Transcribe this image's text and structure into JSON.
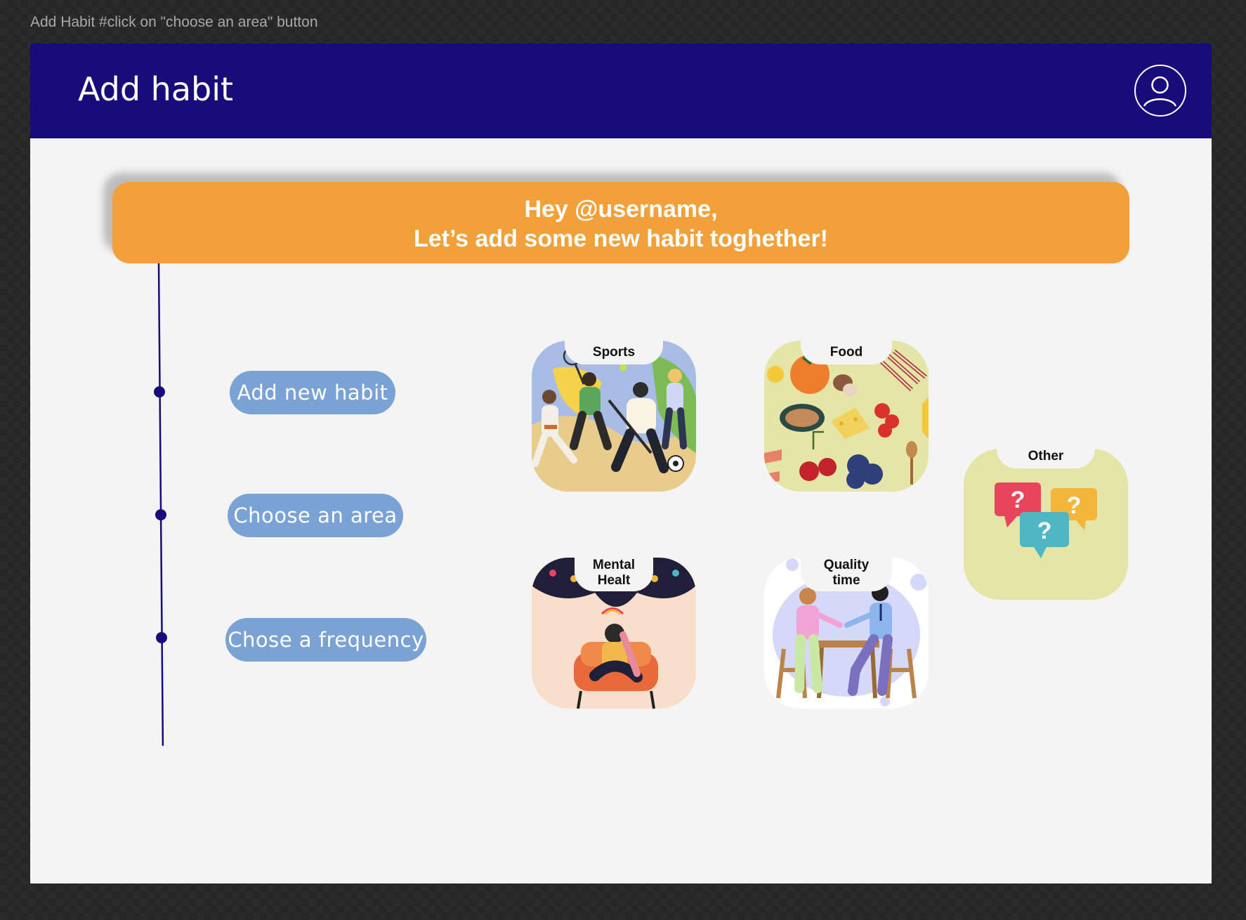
{
  "frame_label": "Add Habit #click on \"choose an area\" button",
  "header": {
    "title": "Add habit",
    "profile_icon": "user-circle-icon",
    "background_color": "#180b7a"
  },
  "greeting": {
    "line1": "Hey @username,",
    "line2": "Let’s add some new habit toghether!",
    "color": "#f2a03a"
  },
  "steps": [
    {
      "label": "Add new habit"
    },
    {
      "label": "Choose an area"
    },
    {
      "label": "Chose a frequency"
    }
  ],
  "areas": {
    "sports": {
      "label": "Sports",
      "icon": "sports-illustration"
    },
    "food": {
      "label": "Food",
      "icon": "food-illustration"
    },
    "mental": {
      "label_line1": "Mental",
      "label_line2": "Healt",
      "icon": "mental-health-illustration"
    },
    "quality": {
      "label_line1": "Quality",
      "label_line2": "time",
      "icon": "quality-time-illustration"
    },
    "other": {
      "label": "Other",
      "icon": "question-bubbles-icon"
    }
  },
  "colors": {
    "step_button": "#7ba2d4",
    "timeline": "#180b7a"
  }
}
